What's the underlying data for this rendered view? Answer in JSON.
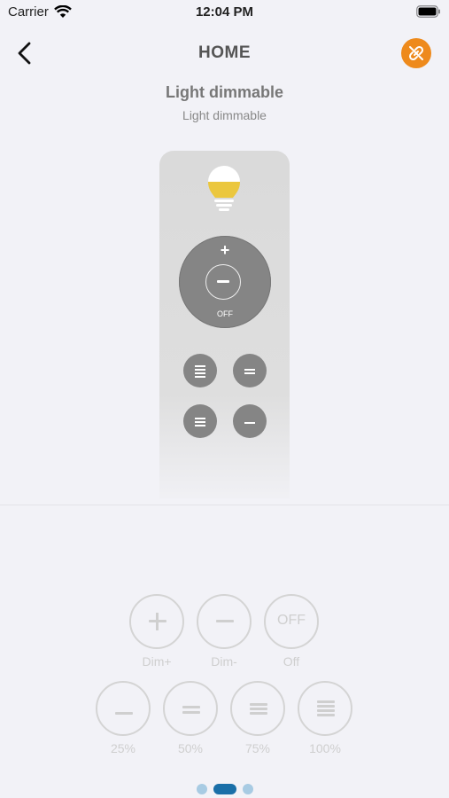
{
  "status_bar": {
    "carrier": "Carrier",
    "time": "12:04 PM"
  },
  "header": {
    "title": "HOME",
    "back_icon": "chevron-left-icon",
    "unlink_icon": "unlink-icon",
    "accent_color": "#ee8a1c"
  },
  "device": {
    "title": "Light dimmable",
    "subtitle": "Light dimmable"
  },
  "remote": {
    "wheel_plus": "+",
    "wheel_off": "OFF",
    "bulb_color": "#ebc73e"
  },
  "controls": {
    "row1": [
      {
        "label": "Dim+",
        "icon": "plus-icon"
      },
      {
        "label": "Dim-",
        "icon": "minus-icon"
      },
      {
        "label": "Off",
        "icon_text": "OFF"
      }
    ],
    "row2": [
      {
        "label": "25%",
        "icon": "one-bar-icon"
      },
      {
        "label": "50%",
        "icon": "two-bars-icon"
      },
      {
        "label": "75%",
        "icon": "three-bars-icon"
      },
      {
        "label": "100%",
        "icon": "four-bars-icon"
      }
    ]
  },
  "pagination": {
    "pages": 3,
    "active": 1,
    "active_color": "#1a6fa8",
    "inactive_color": "#a8cbe3"
  }
}
